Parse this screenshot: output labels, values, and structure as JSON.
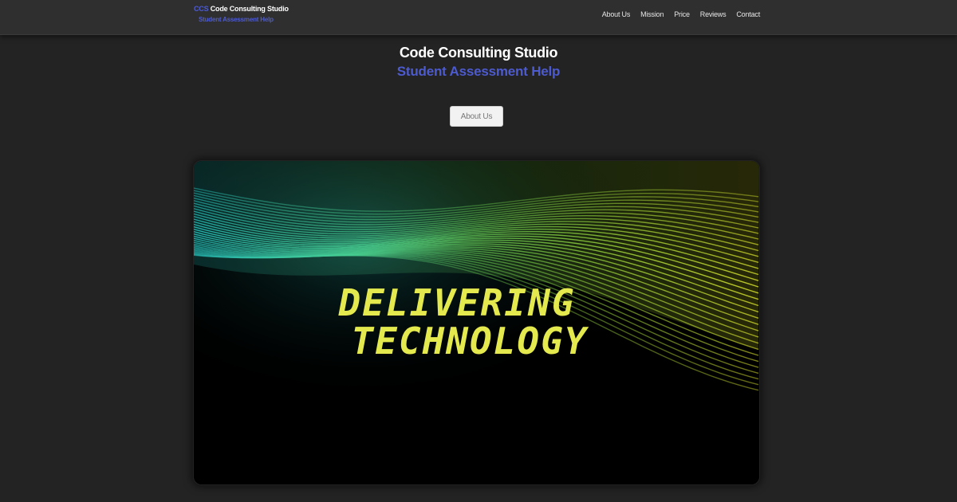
{
  "header": {
    "brand_abbr": "CCS",
    "brand_name": "Code Consulting Studio",
    "brand_tagline": "Student Assessment Help",
    "nav": [
      {
        "label": "About Us"
      },
      {
        "label": "Mission"
      },
      {
        "label": "Price"
      },
      {
        "label": "Reviews"
      },
      {
        "label": "Contact"
      }
    ]
  },
  "hero": {
    "title": "Code Consulting Studio",
    "subtitle": "Student Assessment Help",
    "button_label": "About Us"
  },
  "banner": {
    "line1": "DELIVERING",
    "line2": "TECHNOLOGY"
  },
  "colors": {
    "background": "#232323",
    "navbar": "#2f2f2f",
    "accent": "#4d5bd1",
    "banner_text": "#e4ea4e",
    "wave_start": "#2bd6d0",
    "wave_mid": "#6ed24a",
    "wave_end": "#d7e02c"
  }
}
